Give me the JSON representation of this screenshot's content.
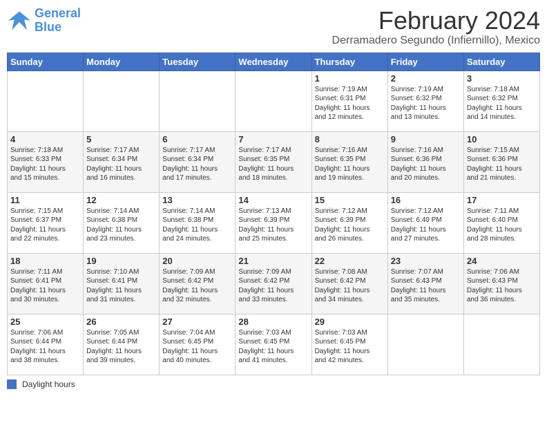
{
  "header": {
    "logo_line1": "General",
    "logo_line2": "Blue",
    "month": "February 2024",
    "location": "Derramadero Segundo (Infiernillo), Mexico"
  },
  "days_of_week": [
    "Sunday",
    "Monday",
    "Tuesday",
    "Wednesday",
    "Thursday",
    "Friday",
    "Saturday"
  ],
  "weeks": [
    [
      {
        "day": "",
        "info": ""
      },
      {
        "day": "",
        "info": ""
      },
      {
        "day": "",
        "info": ""
      },
      {
        "day": "",
        "info": ""
      },
      {
        "day": "1",
        "info": "Sunrise: 7:19 AM\nSunset: 6:31 PM\nDaylight: 11 hours\nand 12 minutes."
      },
      {
        "day": "2",
        "info": "Sunrise: 7:19 AM\nSunset: 6:32 PM\nDaylight: 11 hours\nand 13 minutes."
      },
      {
        "day": "3",
        "info": "Sunrise: 7:18 AM\nSunset: 6:32 PM\nDaylight: 11 hours\nand 14 minutes."
      }
    ],
    [
      {
        "day": "4",
        "info": "Sunrise: 7:18 AM\nSunset: 6:33 PM\nDaylight: 11 hours\nand 15 minutes."
      },
      {
        "day": "5",
        "info": "Sunrise: 7:17 AM\nSunset: 6:34 PM\nDaylight: 11 hours\nand 16 minutes."
      },
      {
        "day": "6",
        "info": "Sunrise: 7:17 AM\nSunset: 6:34 PM\nDaylight: 11 hours\nand 17 minutes."
      },
      {
        "day": "7",
        "info": "Sunrise: 7:17 AM\nSunset: 6:35 PM\nDaylight: 11 hours\nand 18 minutes."
      },
      {
        "day": "8",
        "info": "Sunrise: 7:16 AM\nSunset: 6:35 PM\nDaylight: 11 hours\nand 19 minutes."
      },
      {
        "day": "9",
        "info": "Sunrise: 7:16 AM\nSunset: 6:36 PM\nDaylight: 11 hours\nand 20 minutes."
      },
      {
        "day": "10",
        "info": "Sunrise: 7:15 AM\nSunset: 6:36 PM\nDaylight: 11 hours\nand 21 minutes."
      }
    ],
    [
      {
        "day": "11",
        "info": "Sunrise: 7:15 AM\nSunset: 6:37 PM\nDaylight: 11 hours\nand 22 minutes."
      },
      {
        "day": "12",
        "info": "Sunrise: 7:14 AM\nSunset: 6:38 PM\nDaylight: 11 hours\nand 23 minutes."
      },
      {
        "day": "13",
        "info": "Sunrise: 7:14 AM\nSunset: 6:38 PM\nDaylight: 11 hours\nand 24 minutes."
      },
      {
        "day": "14",
        "info": "Sunrise: 7:13 AM\nSunset: 6:39 PM\nDaylight: 11 hours\nand 25 minutes."
      },
      {
        "day": "15",
        "info": "Sunrise: 7:12 AM\nSunset: 6:39 PM\nDaylight: 11 hours\nand 26 minutes."
      },
      {
        "day": "16",
        "info": "Sunrise: 7:12 AM\nSunset: 6:40 PM\nDaylight: 11 hours\nand 27 minutes."
      },
      {
        "day": "17",
        "info": "Sunrise: 7:11 AM\nSunset: 6:40 PM\nDaylight: 11 hours\nand 28 minutes."
      }
    ],
    [
      {
        "day": "18",
        "info": "Sunrise: 7:11 AM\nSunset: 6:41 PM\nDaylight: 11 hours\nand 30 minutes."
      },
      {
        "day": "19",
        "info": "Sunrise: 7:10 AM\nSunset: 6:41 PM\nDaylight: 11 hours\nand 31 minutes."
      },
      {
        "day": "20",
        "info": "Sunrise: 7:09 AM\nSunset: 6:42 PM\nDaylight: 11 hours\nand 32 minutes."
      },
      {
        "day": "21",
        "info": "Sunrise: 7:09 AM\nSunset: 6:42 PM\nDaylight: 11 hours\nand 33 minutes."
      },
      {
        "day": "22",
        "info": "Sunrise: 7:08 AM\nSunset: 6:42 PM\nDaylight: 11 hours\nand 34 minutes."
      },
      {
        "day": "23",
        "info": "Sunrise: 7:07 AM\nSunset: 6:43 PM\nDaylight: 11 hours\nand 35 minutes."
      },
      {
        "day": "24",
        "info": "Sunrise: 7:06 AM\nSunset: 6:43 PM\nDaylight: 11 hours\nand 36 minutes."
      }
    ],
    [
      {
        "day": "25",
        "info": "Sunrise: 7:06 AM\nSunset: 6:44 PM\nDaylight: 11 hours\nand 38 minutes."
      },
      {
        "day": "26",
        "info": "Sunrise: 7:05 AM\nSunset: 6:44 PM\nDaylight: 11 hours\nand 39 minutes."
      },
      {
        "day": "27",
        "info": "Sunrise: 7:04 AM\nSunset: 6:45 PM\nDaylight: 11 hours\nand 40 minutes."
      },
      {
        "day": "28",
        "info": "Sunrise: 7:03 AM\nSunset: 6:45 PM\nDaylight: 11 hours\nand 41 minutes."
      },
      {
        "day": "29",
        "info": "Sunrise: 7:03 AM\nSunset: 6:45 PM\nDaylight: 11 hours\nand 42 minutes."
      },
      {
        "day": "",
        "info": ""
      },
      {
        "day": "",
        "info": ""
      }
    ]
  ],
  "footer": {
    "legend_label": "Daylight hours"
  }
}
